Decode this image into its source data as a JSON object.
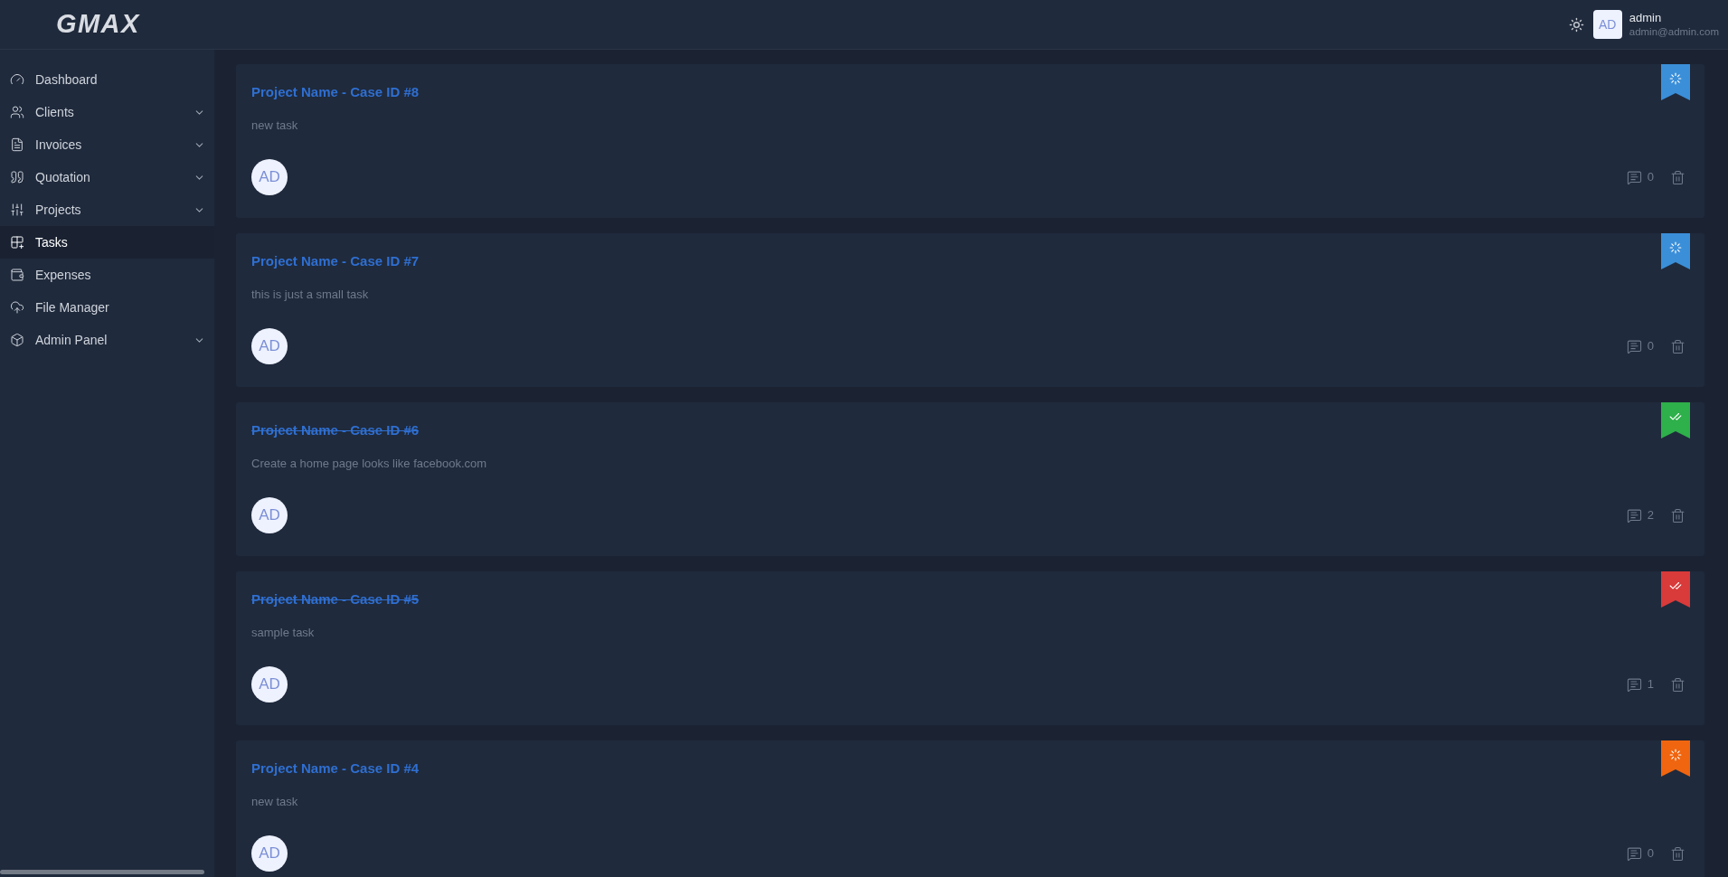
{
  "logo": "GMAX",
  "user": {
    "initials": "AD",
    "name": "admin",
    "email": "admin@admin.com"
  },
  "sidebar": {
    "items": [
      {
        "label": "Dashboard",
        "expandable": false,
        "selected": false
      },
      {
        "label": "Clients",
        "expandable": true,
        "selected": false
      },
      {
        "label": "Invoices",
        "expandable": true,
        "selected": false
      },
      {
        "label": "Quotation",
        "expandable": true,
        "selected": false
      },
      {
        "label": "Projects",
        "expandable": true,
        "selected": false
      },
      {
        "label": "Tasks",
        "expandable": false,
        "selected": true
      },
      {
        "label": "Expenses",
        "expandable": false,
        "selected": false
      },
      {
        "label": "File Manager",
        "expandable": false,
        "selected": false
      },
      {
        "label": "Admin Panel",
        "expandable": true,
        "selected": false
      }
    ]
  },
  "tasks": [
    {
      "title": "Project Name - Case ID #8",
      "description": "new task",
      "assignee": "AD",
      "comments": "0",
      "kind": "progress",
      "completed": false,
      "color": "#3b8fd9"
    },
    {
      "title": "Project Name - Case ID #7",
      "description": "this is just a small task",
      "assignee": "AD",
      "comments": "0",
      "kind": "progress",
      "completed": false,
      "color": "#3b8fd9"
    },
    {
      "title": "Project Name - Case ID #6",
      "description": "Create a home page looks like facebook.com",
      "assignee": "AD",
      "comments": "2",
      "kind": "done",
      "completed": true,
      "color": "#2eb04a"
    },
    {
      "title": "Project Name - Case ID #5",
      "description": "sample task",
      "assignee": "AD",
      "comments": "1",
      "kind": "done",
      "completed": true,
      "color": "#d93a3a"
    },
    {
      "title": "Project Name - Case ID #4",
      "description": "new task",
      "assignee": "AD",
      "comments": "0",
      "kind": "progress",
      "completed": false,
      "color": "#f0650f"
    }
  ]
}
